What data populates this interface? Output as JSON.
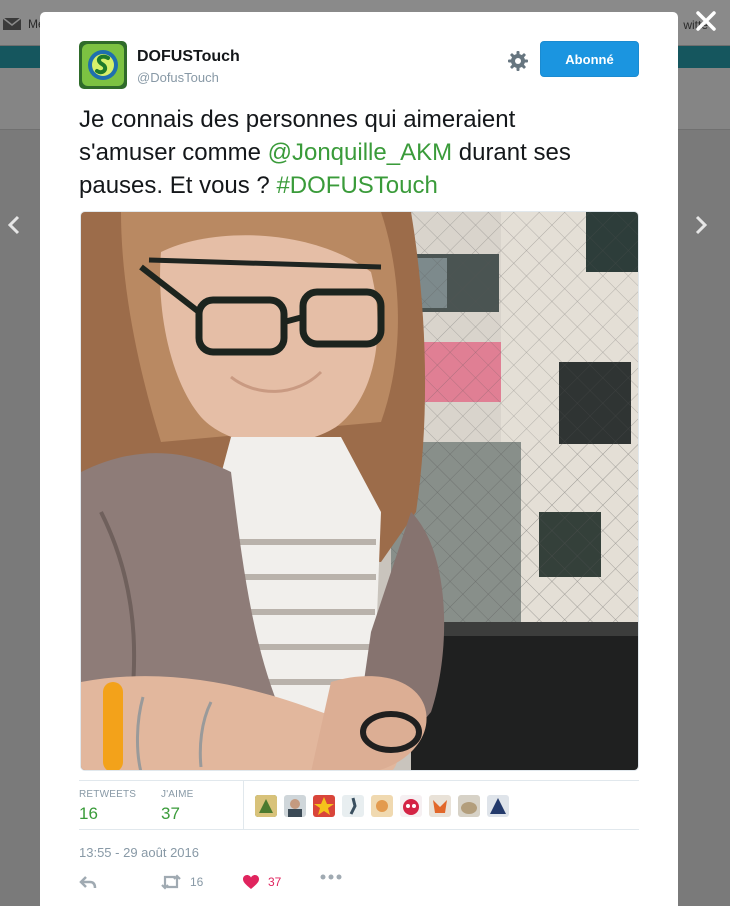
{
  "background": {
    "left_text": "Me",
    "right_text": "witte"
  },
  "tweet": {
    "display_name": "DOFUSTouch",
    "handle": "@DofusTouch",
    "follow_label": "Abonné",
    "text_line1": "Je connais des personnes qui aimeraient",
    "text_line2_pre": "s'amuser comme ",
    "mention": "@Jonquille_AKM",
    "text_line2_post": " durant ses",
    "text_line3_pre": "pauses. Et vous ? ",
    "hashtag": "#DOFUSTouch",
    "stats": {
      "retweets_label": "RETWEETS",
      "retweets_value": "16",
      "likes_label": "J'AIME",
      "likes_value": "37"
    },
    "timestamp": "13:55 - 29 août 2016",
    "actions": {
      "retweet_count": "16",
      "like_count": "37"
    }
  },
  "colors": {
    "accent_blue": "#1b95e0",
    "link_green": "#3a9b3a",
    "like_red": "#e0245e",
    "muted": "#8899a6"
  },
  "icons": [
    "mail-icon",
    "close-icon",
    "chevron-left-icon",
    "chevron-right-icon",
    "gear-icon",
    "reply-icon",
    "retweet-icon",
    "heart-icon",
    "more-icon"
  ]
}
